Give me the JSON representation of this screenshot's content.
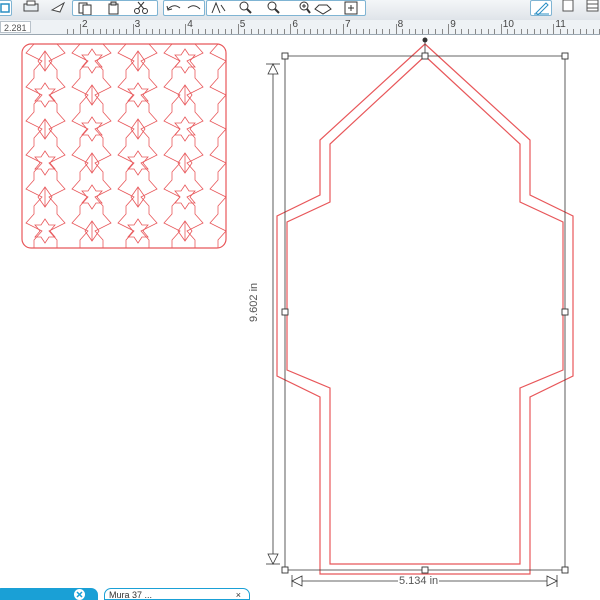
{
  "toolbar": {
    "buttons": [
      {
        "name": "sidebar-toggle-button",
        "icon": "panel-icon"
      },
      {
        "name": "print-button",
        "icon": "print-icon"
      },
      {
        "name": "send-button",
        "icon": "send-icon"
      },
      {
        "name": "copy-button",
        "icon": "copy-icon"
      },
      {
        "name": "paste-button",
        "icon": "paste-icon"
      },
      {
        "name": "cut-button",
        "icon": "scissors-icon"
      },
      {
        "name": "undo-button",
        "icon": "undo-icon"
      },
      {
        "name": "redo-button",
        "icon": "redo-icon"
      },
      {
        "name": "select-tool-button",
        "icon": "arrow-icon"
      },
      {
        "name": "zoom-in-button",
        "icon": "zoom-in-icon"
      },
      {
        "name": "zoom-out-button",
        "icon": "zoom-out-icon"
      },
      {
        "name": "zoom-fit-button",
        "icon": "zoom-fit-icon"
      },
      {
        "name": "draw-tool-button",
        "icon": "diamond-icon"
      },
      {
        "name": "zoom-select-button",
        "icon": "zoom-box-icon"
      },
      {
        "name": "edit-points-button",
        "icon": "pencil-icon"
      },
      {
        "name": "page-setup-button",
        "icon": "page-icon"
      }
    ]
  },
  "ruler": {
    "readout": "2.281",
    "labels": [
      "2",
      "3",
      "4",
      "5",
      "6",
      "7",
      "8",
      "9",
      "10",
      "11"
    ]
  },
  "canvas": {
    "height_label": "9.602 in",
    "width_label": "5.134 in",
    "line_color": "#e8575a",
    "guide_color": "#333333"
  },
  "tabs": {
    "active_color": "#1aa0d6",
    "second_label": "Mura 37 ..."
  }
}
